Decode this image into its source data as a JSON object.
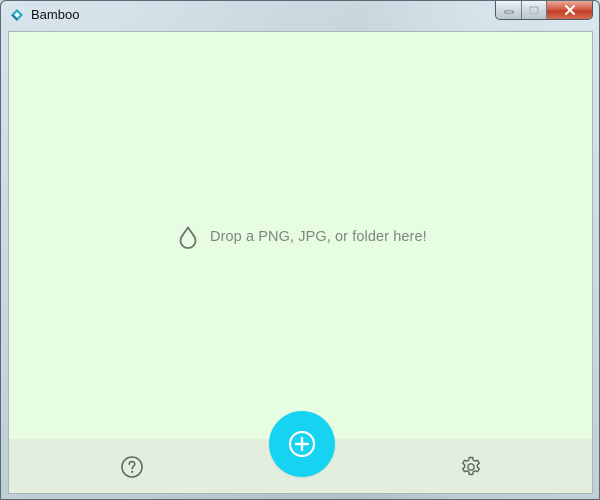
{
  "window": {
    "title": "Bamboo",
    "app_icon": "bamboo-logo-icon",
    "caption_buttons": [
      "minimize-icon",
      "maximize-icon",
      "close-icon"
    ]
  },
  "drop_zone": {
    "icon": "droplet-icon",
    "text": "Drop a PNG, JPG, or folder here!"
  },
  "footer": {
    "help_icon": "help-icon",
    "add_icon": "add-icon",
    "settings_icon": "gear-icon"
  },
  "colors": {
    "background": "#e6fde1",
    "footer": "#e4eedf",
    "accent": "#16d3f2",
    "hint_text": "#7e8680"
  }
}
